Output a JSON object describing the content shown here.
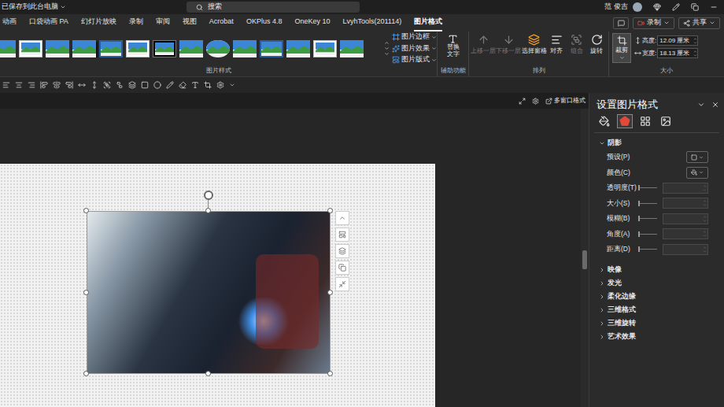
{
  "title_bar": {
    "save_status": "已保存到此台电脑",
    "search_placeholder": "搜索",
    "user": "范 俊吉"
  },
  "ribbon_tabs": [
    {
      "label": "动画",
      "selected": false
    },
    {
      "label": "口袋动画 PA",
      "selected": false
    },
    {
      "label": "幻灯片放映",
      "selected": false
    },
    {
      "label": "录制",
      "selected": false
    },
    {
      "label": "审阅",
      "selected": false
    },
    {
      "label": "视图",
      "selected": false
    },
    {
      "label": "Acrobat",
      "selected": false
    },
    {
      "label": "OKPlus 4.8",
      "selected": false
    },
    {
      "label": "OneKey 10",
      "selected": false
    },
    {
      "label": "LvyhTools(201114)",
      "selected": false
    },
    {
      "label": "图片格式",
      "selected": true
    }
  ],
  "ribbon_actions": [
    {
      "label": "录制",
      "kind": "record"
    },
    {
      "label": "共享",
      "kind": "share"
    }
  ],
  "picture_styles": {
    "label": "图片样式",
    "thumbnails": [
      {
        "kind": "plain"
      },
      {
        "kind": "white-frame"
      },
      {
        "kind": "plain"
      },
      {
        "kind": "shadow"
      },
      {
        "kind": "bevel"
      },
      {
        "kind": "white-frame"
      },
      {
        "kind": "black-frame"
      },
      {
        "kind": "plain"
      },
      {
        "kind": "oval"
      },
      {
        "kind": "plain"
      },
      {
        "kind": "bevel"
      },
      {
        "kind": "plain"
      },
      {
        "kind": "white-frame"
      },
      {
        "kind": "plain"
      }
    ],
    "buttons": [
      {
        "label": "图片边框",
        "kind": "border"
      },
      {
        "label": "图片效果",
        "kind": "effects"
      },
      {
        "label": "图片版式",
        "kind": "layout"
      }
    ]
  },
  "accessibility": {
    "label": "辅助功能",
    "button": "替换文字"
  },
  "arrange": {
    "label": "排列",
    "buttons": [
      {
        "label": "上移一层",
        "kind": "forward",
        "disabled": true
      },
      {
        "label": "下移一层",
        "kind": "backward",
        "disabled": true
      },
      {
        "label": "选择窗格",
        "kind": "pane",
        "disabled": false
      },
      {
        "label": "对齐",
        "kind": "align",
        "disabled": false
      },
      {
        "label": "组合",
        "kind": "group",
        "disabled": true
      },
      {
        "label": "旋转",
        "kind": "rotate",
        "disabled": false
      }
    ]
  },
  "size": {
    "label": "大小",
    "crop": "裁剪",
    "fields": [
      {
        "label": "高度:",
        "value": "12.09 厘米",
        "kind": "height"
      },
      {
        "label": "宽度:",
        "value": "18.13 厘米",
        "kind": "width"
      }
    ]
  },
  "canvas": {
    "toolbar_label": "多窗口格式"
  },
  "panel": {
    "title": "设置图片格式",
    "tabs": [
      {
        "kind": "fill",
        "selected": false
      },
      {
        "kind": "effects",
        "selected": true
      },
      {
        "kind": "size",
        "selected": false
      },
      {
        "kind": "picture",
        "selected": false
      }
    ],
    "sections": [
      {
        "label": "阴影",
        "expanded": true
      },
      {
        "label": "映像",
        "expanded": false
      },
      {
        "label": "发光",
        "expanded": false
      },
      {
        "label": "柔化边缘",
        "expanded": false
      },
      {
        "label": "三维格式",
        "expanded": false
      },
      {
        "label": "三维旋转",
        "expanded": false
      },
      {
        "label": "艺术效果",
        "expanded": false
      }
    ],
    "shadow_rows": [
      {
        "label": "预设(P)",
        "kind": "preset"
      },
      {
        "label": "颜色(C)",
        "kind": "color"
      },
      {
        "label": "透明度(T)",
        "kind": "slider",
        "level": 0,
        "disabled": true
      },
      {
        "label": "大小(S)",
        "kind": "slider",
        "level": 0,
        "disabled": true
      },
      {
        "label": "模糊(B)",
        "kind": "slider",
        "level": 0,
        "disabled": true
      },
      {
        "label": "角度(A)",
        "kind": "slider",
        "level": 0,
        "disabled": true
      },
      {
        "label": "距离(D)",
        "kind": "slider",
        "level": 0,
        "disabled": true
      }
    ]
  }
}
